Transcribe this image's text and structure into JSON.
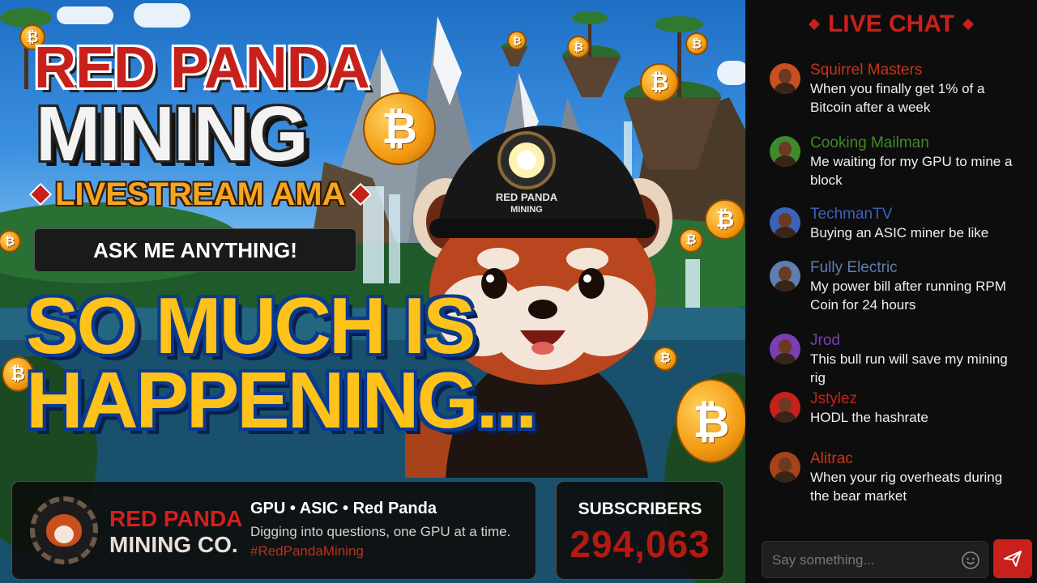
{
  "thumbnail": {
    "title_line1": "RED PANDA",
    "title_line2": "MINING",
    "subtitle": "LIVESTREAM AMA",
    "ask_label": "ASK ME ANYTHING!",
    "headline_line1": "SO MUCH IS",
    "headline_line2": "HAPPENING...",
    "helmet_text_line1": "RED PANDA",
    "helmet_text_line2": "MINING",
    "coin_symbol": "₿"
  },
  "brand": {
    "name_line1": "RED PANDA",
    "name_line2": "MINING CO.",
    "tags": "GPU • ASIC • Red Panda",
    "tagline": "Digging into questions, one GPU at a time.",
    "hashtag": "#RedPandaMining"
  },
  "subscribers": {
    "label": "SUBSCRIBERS",
    "count": "294,063"
  },
  "chat": {
    "title": "LIVE CHAT",
    "messages": [
      {
        "name": "Squirrel Masters",
        "text": "When you finally get 1% of a Bitcoin after a week",
        "name_color": "#c8351a"
      },
      {
        "name": "Cooking Mailman",
        "text": "Me waiting for my GPU to mine a block",
        "name_color": "#3f8a2c"
      },
      {
        "name": "TechmanTV",
        "text": "Buying an ASIC miner be like",
        "name_color": "#3b63b8"
      },
      {
        "name": "Fully Electric",
        "text": "My power bill after running RPM Coin for 24 hours",
        "name_color": "#5e7fb0"
      },
      {
        "name": "Jrod",
        "text": "This bull run will save my mining rig",
        "name_color": "#7a3fb0"
      },
      {
        "name": "Jstylez",
        "text": "HODL the hashrate",
        "name_color": "#c8201a"
      },
      {
        "name": "Alitrac",
        "text": "When your rig overheats during the bear market",
        "name_color": "#c8351a"
      }
    ],
    "input_placeholder": "Say something...",
    "colors": {
      "accent": "#c8201a",
      "panel": "#0d0d0d"
    }
  }
}
